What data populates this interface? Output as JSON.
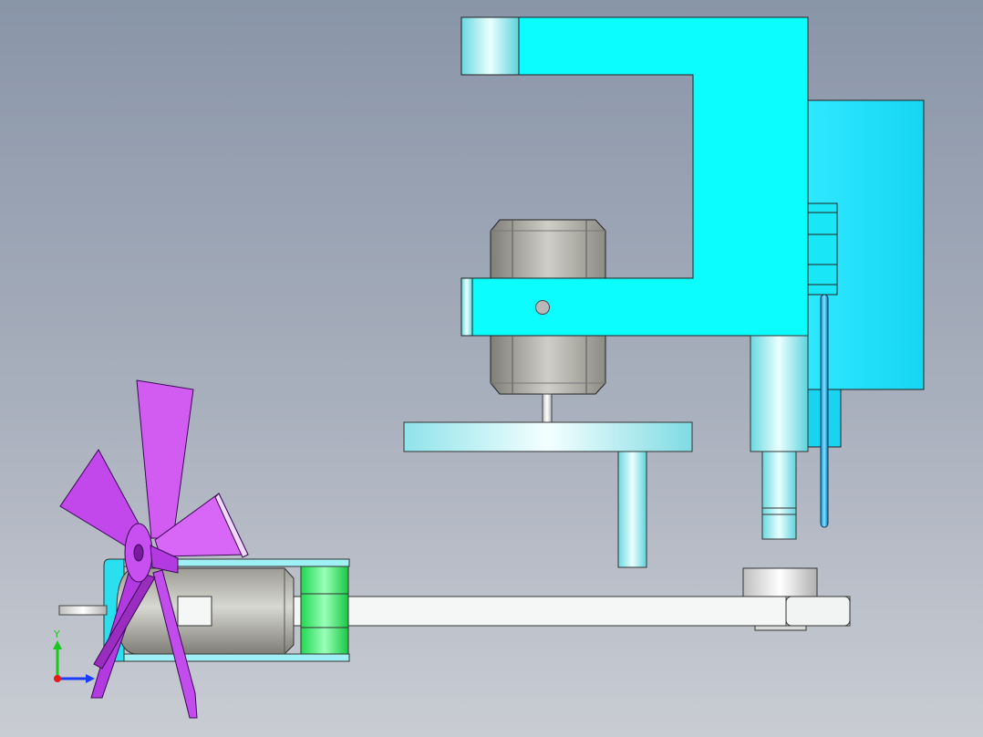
{
  "viewport": {
    "background_top": "#8995a8",
    "background_bottom": "#c9ccd3"
  },
  "colors": {
    "frame": "#0bfdfd",
    "frame_shade": "#06d8e6",
    "panel": "#19def8",
    "motor_body": "#b5b5ad",
    "motor_dark": "#8a8a83",
    "fan": "#cc4ef0",
    "fan_dark": "#9a2cc0",
    "spacer_green": "#33ee66",
    "white_part": "#f5f7f7"
  },
  "triad": {
    "y_label": "Y",
    "x_axis_color": "#1a3cff",
    "y_axis_color": "#19c81e",
    "z_axis_color": "#e51a1a"
  }
}
